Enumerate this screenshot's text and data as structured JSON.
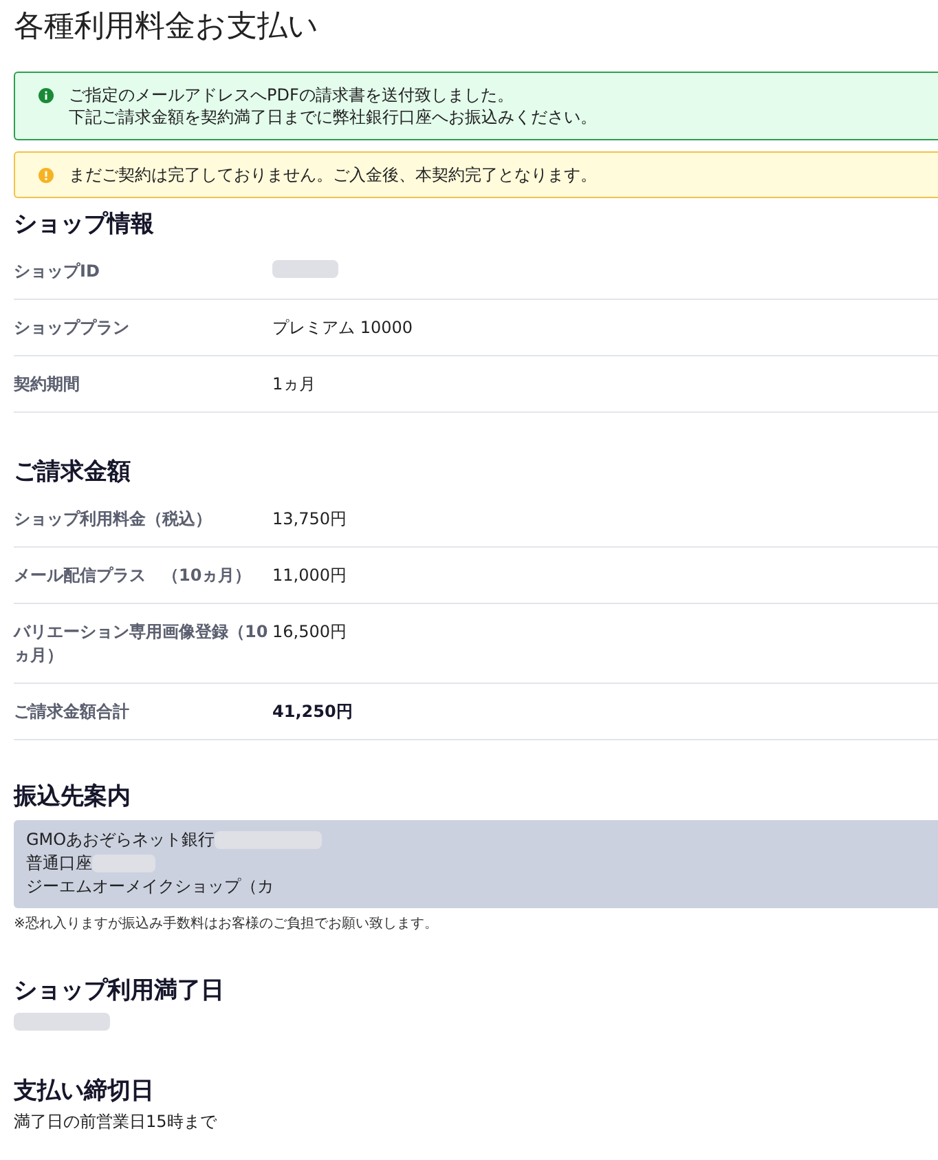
{
  "page": {
    "title": "各種利用料金お支払い"
  },
  "alerts": [
    {
      "kind": "success",
      "lines": [
        "ご指定のメールアドレスへPDFの請求書を送付致しました。",
        "下記ご請求金額を契約満了日までに弊社銀行口座へお振込みください。"
      ]
    },
    {
      "kind": "warning",
      "lines": [
        "まだご契約は完了しておりません。ご入金後、本契約完了となります。"
      ]
    }
  ],
  "shop_info": {
    "heading": "ショップ情報",
    "rows": [
      {
        "kind": "redacted",
        "label": "ショップID"
      },
      {
        "kind": "plain",
        "label": "ショッププラン",
        "value": "プレミアム 10000"
      },
      {
        "kind": "plain",
        "label": "契約期間",
        "value": "1ヵ月"
      }
    ]
  },
  "billing": {
    "heading": "ご請求金額",
    "rows": [
      {
        "kind": "plain",
        "label": "ショップ利用料金（税込）",
        "value": "13,750円"
      },
      {
        "kind": "plain",
        "label": "メール配信プラス　（10ヵ月）",
        "value": "11,000円"
      },
      {
        "kind": "plain",
        "label": "バリエーション専用画像登録（10ヵ月）",
        "value": "16,500円"
      },
      {
        "kind": "total",
        "label": "ご請求金額合計",
        "value": "41,250円"
      }
    ]
  },
  "transfer": {
    "heading": "振込先案内",
    "lines": [
      {
        "kind": "masked",
        "text": "GMOあおぞらネット銀行"
      },
      {
        "kind": "masked",
        "text": "普通口座"
      },
      {
        "kind": "plain",
        "text": "ジーエムオーメイクショップ（カ"
      }
    ],
    "note": "※恐れ入りますが振込み手数料はお客様のご負担でお願い致します。"
  },
  "expiry": {
    "heading": "ショップ利用満了日",
    "redacted": true
  },
  "deadline": {
    "heading": "支払い締切日",
    "value": "満了日の前営業日15時まで"
  }
}
